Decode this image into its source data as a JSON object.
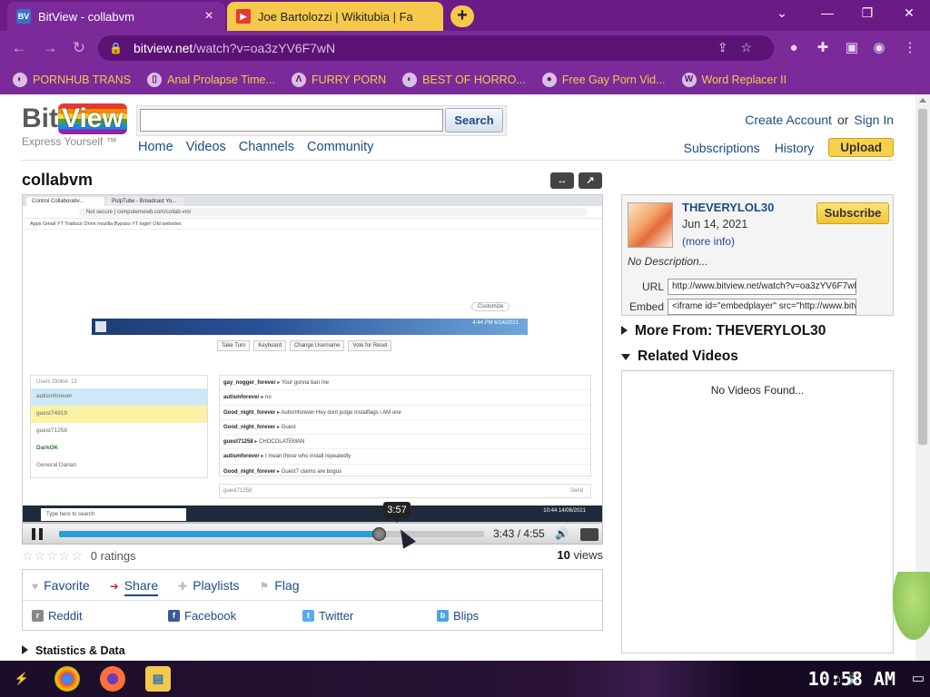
{
  "browser": {
    "tabs": [
      {
        "title": "BitView - collabvm",
        "favicon": "bitview-icon"
      },
      {
        "title": "Joe Bartolozzi | Wikitubia | Fa",
        "favicon": "youtube-icon"
      }
    ],
    "new_tab": "+",
    "url_host": "bitview.net",
    "url_path": "/watch?v=oa3zYV6F7wN",
    "bookmarks": [
      "PORNHUB TRANS",
      "Anal Prolapse Time...",
      "FURRY PORN",
      "BEST OF HORRO...",
      "Free Gay Porn Vid...",
      "Word Replacer II"
    ]
  },
  "site": {
    "logo_bit": "Bit",
    "logo_view": "View",
    "tagline": "Express Yourself ™",
    "search_button": "Search",
    "search_value": "",
    "nav": [
      "Home",
      "Videos",
      "Channels",
      "Community"
    ],
    "create_account": "Create Account",
    "or": "or",
    "sign_in": "Sign In",
    "subscriptions": "Subscriptions",
    "history": "History",
    "upload": "Upload"
  },
  "video": {
    "title": "collabvm",
    "tooltip_time": "3:57",
    "current_time": "3:43 / 4:55",
    "progress_fraction": 0.755,
    "ratings": "0 ratings",
    "views_count": "10",
    "views_label": "views",
    "actions": [
      "Favorite",
      "Share",
      "Playlists",
      "Flag"
    ],
    "share": [
      "Reddit",
      "Facebook",
      "Twitter",
      "Blips"
    ],
    "stats_label": "Statistics & Data",
    "screen": {
      "tabs": [
        "Control Collaborativ...",
        "PulpTube - Broadcast Yo..."
      ],
      "address": "Not secure | computernewb.com/collab-vm/",
      "bookmarks": "Apps   Gmail   YT   Traducir   Drive   mozilla   Bypass YT login!   Old websites",
      "customize": "Customize",
      "clock": "4:44 PM\n6/14/2021",
      "buttons": [
        "Take Turn",
        "Keyboard",
        "Change Username",
        "Vote for Reset"
      ],
      "users_header": "Users Online: 13",
      "users": [
        "autismforever",
        "guest74919",
        "guest71258",
        "DarkOK",
        "General Darian"
      ],
      "chat": [
        {
          "user": "gay_nogger_forever",
          "msg": "Your gonna ban me"
        },
        {
          "user": "autismforever",
          "msg": "no"
        },
        {
          "user": "Good_night_forever",
          "msg": "Autismforever Hey dont judge installfags i AM one"
        },
        {
          "user": "Good_night_forever",
          "msg": "Guest"
        },
        {
          "user": "guest71258",
          "msg": "CHOCOLATEMAN"
        },
        {
          "user": "autismforever",
          "msg": "I mean those who install repeatedly"
        },
        {
          "user": "Good_night_forever",
          "msg": "Guest7 claims are bogus"
        }
      ],
      "chat_input_user": "guest71258",
      "send": "Send",
      "taskbar_search": "Type here to search",
      "taskbar_time": "10:44\n14/06/2021"
    }
  },
  "channel": {
    "name": "THEVERYLOL30",
    "date": "Jun 14, 2021",
    "more_info": "(more info)",
    "subscribe": "Subscribe",
    "description": "No Description...",
    "url_label": "URL",
    "url_value": "http://www.bitview.net/watch?v=oa3zYV6F7wN",
    "embed_label": "Embed",
    "embed_value": "<iframe id=\"embedplayer\" src=\"http://www.bitview.net/embed",
    "more_from": "More From: THEVERYLOL30",
    "related": "Related Videos",
    "no_videos": "No Videos Found..."
  },
  "taskbar": {
    "clock": "10:58 AM"
  },
  "colors": {
    "browser_frame": "#7b2a99",
    "accent_yellow": "#f6c94a",
    "link_blue": "#1c4b8a",
    "progress": "#2a9fd6"
  }
}
